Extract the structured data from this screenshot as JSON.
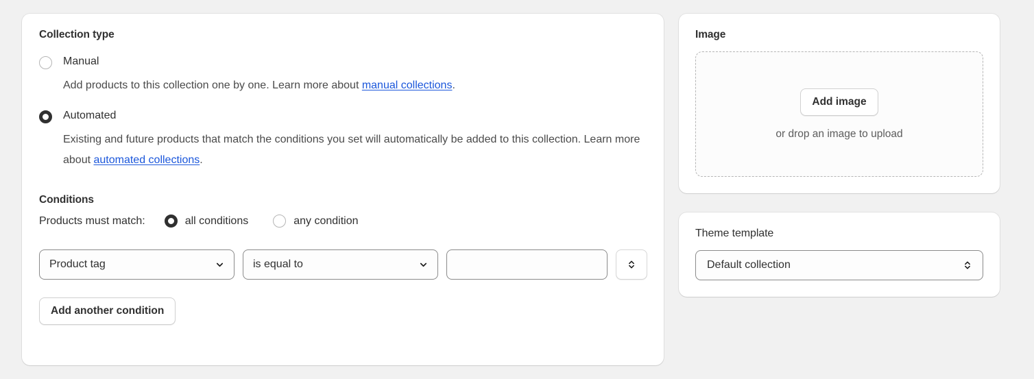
{
  "collection_type": {
    "title": "Collection type",
    "options": [
      {
        "label": "Manual",
        "selected": false,
        "description_before": "Add products to this collection one by one. Learn more about ",
        "link_text": "manual collections",
        "description_after": "."
      },
      {
        "label": "Automated",
        "selected": true,
        "description_before": "Existing and future products that match the conditions you set will automatically be added to this collection. Learn more about ",
        "link_text": "automated collections",
        "description_after": "."
      }
    ]
  },
  "conditions": {
    "title": "Conditions",
    "match_label": "Products must match:",
    "match_options": [
      {
        "label": "all conditions",
        "selected": true
      },
      {
        "label": "any condition",
        "selected": false
      }
    ],
    "row": {
      "property": "Product tag",
      "operator": "is equal to",
      "value": "",
      "value_placeholder": ""
    },
    "add_button": "Add another condition"
  },
  "image_card": {
    "title": "Image",
    "add_button": "Add image",
    "drop_hint": "or drop an image to upload"
  },
  "theme_card": {
    "title": "Theme template",
    "selected": "Default collection"
  },
  "colors": {
    "page_background": "#f1f1f1",
    "card_background": "#ffffff",
    "text": "#303030",
    "subdued_text": "#4a4a4a",
    "link": "#1a56db",
    "border": "#8a8a8a",
    "radio_selected": "#303030"
  },
  "icons": {
    "chevron_down": "chevron-down-icon",
    "stepper": "stepper-updown-icon"
  }
}
